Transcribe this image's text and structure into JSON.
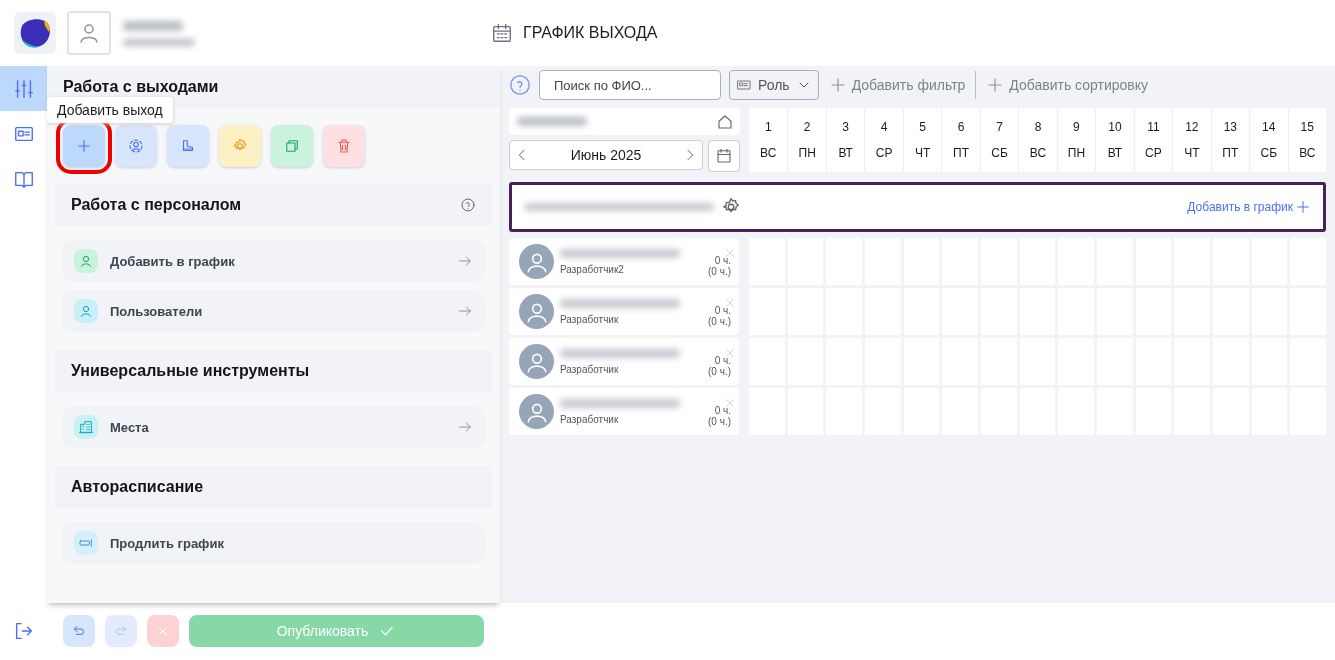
{
  "header": {
    "title": "ГРАФИК ВЫХОДА"
  },
  "rail": [
    {
      "kind": "sliders",
      "selected": true
    },
    {
      "kind": "card",
      "selected": false
    },
    {
      "kind": "book",
      "selected": false
    }
  ],
  "panel": {
    "title": "Работа с выходами",
    "tooltip": "Добавить выход",
    "actions": [
      {
        "kind": "add",
        "highlighted": true
      },
      {
        "kind": "person",
        "highlighted": false
      },
      {
        "kind": "boot",
        "highlighted": false
      },
      {
        "kind": "gear",
        "highlighted": false
      },
      {
        "kind": "copy",
        "highlighted": false
      },
      {
        "kind": "trash",
        "highlighted": false
      }
    ],
    "sections": [
      {
        "title": "Работа с персоналом",
        "help": true,
        "items": [
          {
            "label": "Добавить в график",
            "kind": "person-green",
            "arrow": true
          },
          {
            "label": "Пользователи",
            "kind": "person-cyan",
            "arrow": true
          }
        ]
      },
      {
        "title": "Универсальные инструменты",
        "help": false,
        "items": [
          {
            "label": "Места",
            "kind": "building",
            "arrow": true
          }
        ]
      },
      {
        "title": "Авторасписание",
        "help": false,
        "items": [
          {
            "label": "Продлить график",
            "kind": "extend",
            "arrow": false
          }
        ]
      }
    ]
  },
  "footer": {
    "undo_disabled": false,
    "redo_disabled": true,
    "cancel_disabled": true,
    "publish": {
      "label": "Опубликовать",
      "disabled": true
    }
  },
  "toolbar": {
    "search": {
      "placeholder": "Поиск по ФИО..."
    },
    "role": "Роль",
    "add_filter": "Добавить фильтр",
    "add_sort": "Добавить сортировку"
  },
  "calendar": {
    "month": "Июнь 2025",
    "days": [
      {
        "day": "1",
        "weekday": "ВС"
      },
      {
        "day": "2",
        "weekday": "ПН"
      },
      {
        "day": "3",
        "weekday": "ВТ"
      },
      {
        "day": "4",
        "weekday": "СР"
      },
      {
        "day": "5",
        "weekday": "ЧТ"
      },
      {
        "day": "6",
        "weekday": "ПТ"
      },
      {
        "day": "7",
        "weekday": "СБ"
      },
      {
        "day": "8",
        "weekday": "ВС"
      },
      {
        "day": "9",
        "weekday": "ПН"
      },
      {
        "day": "10",
        "weekday": "ВТ"
      },
      {
        "day": "11",
        "weekday": "СР"
      },
      {
        "day": "12",
        "weekday": "ЧТ"
      },
      {
        "day": "13",
        "weekday": "ПТ"
      },
      {
        "day": "14",
        "weekday": "СБ"
      },
      {
        "day": "15",
        "weekday": "ВС"
      }
    ]
  },
  "place": {
    "action": "Добавить в график"
  },
  "employees": [
    {
      "role": "Разработчик2",
      "hours": "0 ч.",
      "planned": "(0 ч.)"
    },
    {
      "role": "Разработчик",
      "hours": "0 ч.",
      "planned": "(0 ч.)"
    },
    {
      "role": "Разработчик",
      "hours": "0 ч.",
      "planned": "(0 ч.)"
    },
    {
      "role": "Разработчик",
      "hours": "0 ч.",
      "planned": "(0 ч.)"
    }
  ]
}
